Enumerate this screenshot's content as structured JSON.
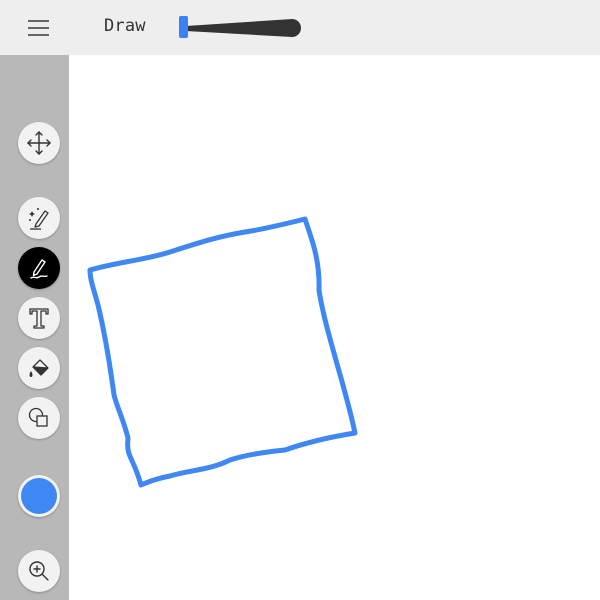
{
  "app": {
    "title": "Draw"
  },
  "toolbar": {
    "menu_icon": "hamburger-menu-icon",
    "stroke_size": {
      "value": 0.05,
      "slider_color": "#3b82f6",
      "track_color": "#333333"
    }
  },
  "tools": [
    {
      "id": "move",
      "icon": "move-arrows-icon",
      "active": false
    },
    {
      "id": "magic-draw",
      "icon": "magic-pencil-icon",
      "active": false
    },
    {
      "id": "pen",
      "icon": "pen-icon",
      "active": true
    },
    {
      "id": "text",
      "icon": "text-icon",
      "active": false
    },
    {
      "id": "fill",
      "icon": "paint-bucket-icon",
      "active": false
    },
    {
      "id": "shapes",
      "icon": "shapes-icon",
      "active": false
    }
  ],
  "color": {
    "current": "#3f87f2"
  },
  "zoom": {
    "icon": "zoom-in-icon"
  },
  "drawing": {
    "stroke_color": "#3f87f2"
  }
}
